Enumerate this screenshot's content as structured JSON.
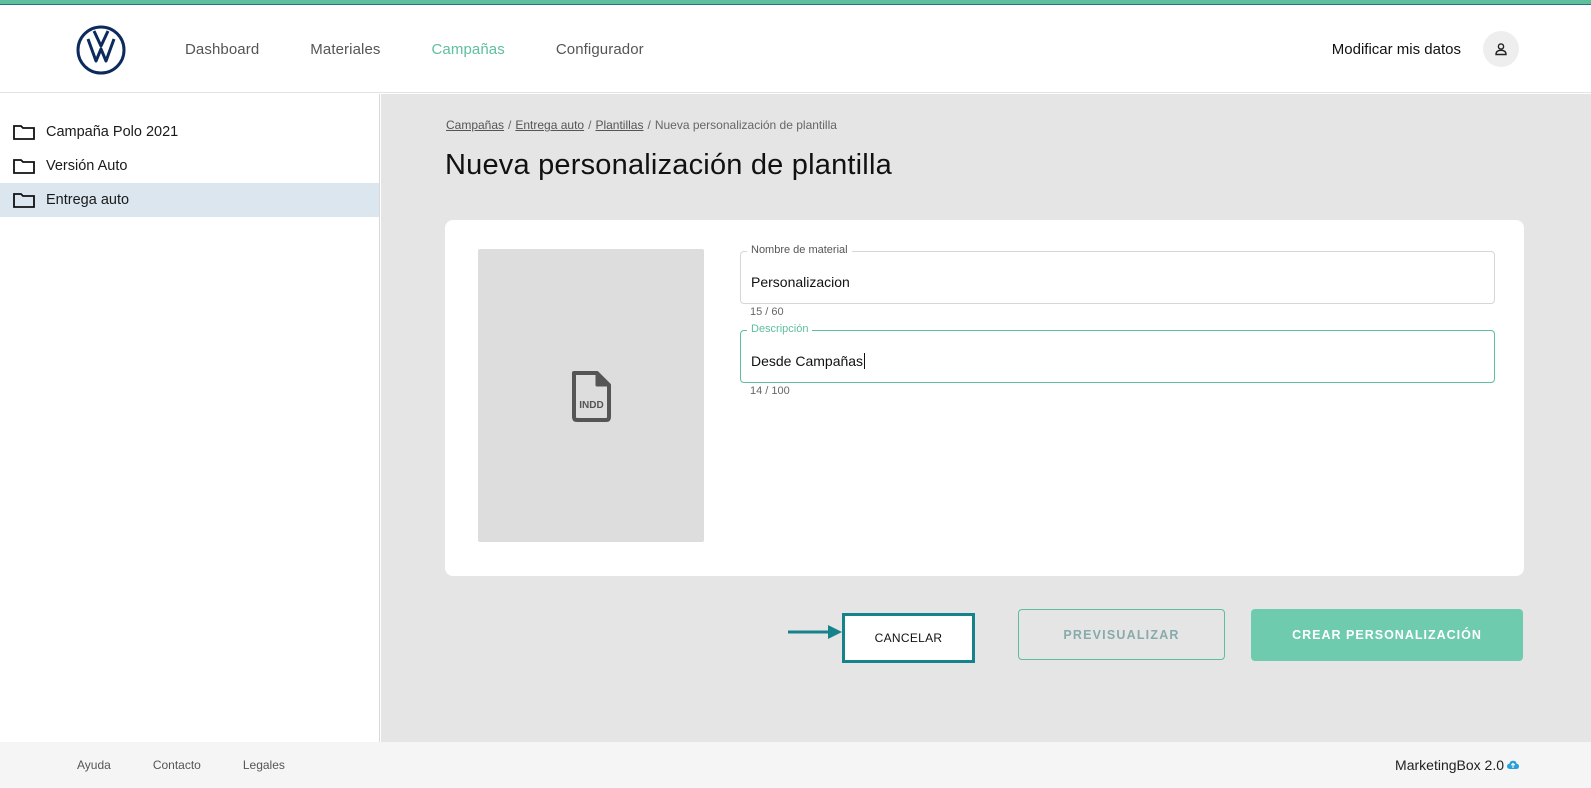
{
  "header": {
    "nav": [
      {
        "label": "Dashboard"
      },
      {
        "label": "Materiales"
      },
      {
        "label": "Campañas"
      },
      {
        "label": "Configurador"
      }
    ],
    "active_nav": "Campañas",
    "user_link": "Modificar mis datos",
    "user_icon": "user-icon"
  },
  "sidebar": {
    "items": [
      {
        "label": "Campaña Polo 2021"
      },
      {
        "label": "Versión Auto"
      },
      {
        "label": "Entrega auto"
      }
    ],
    "selected": "Entrega auto"
  },
  "breadcrumb": {
    "items": [
      "Campañas",
      "Entrega auto",
      "Plantillas"
    ],
    "current": "Nueva personalización de plantilla",
    "separator": "/"
  },
  "page": {
    "title": "Nueva personalización de plantilla"
  },
  "form": {
    "thumbnail_label": "INDD",
    "name_field": {
      "label": "Nombre de material",
      "value": "Personalizacion",
      "counter": "15 / 60"
    },
    "description_field": {
      "label": "Descripción",
      "value": "Desde Campañas",
      "counter": "14 / 100"
    }
  },
  "actions": {
    "cancel": "CANCELAR",
    "preview": "PREVISUALIZAR",
    "create": "CREAR PERSONALIZACIÓN"
  },
  "footer": {
    "links": [
      "Ayuda",
      "Contacto",
      "Legales"
    ],
    "brand": "MarketingBox 2.0"
  },
  "colors": {
    "accent": "#5dbf9b",
    "highlight_border": "#16838a",
    "selected_bg": "#dbe6ef"
  }
}
